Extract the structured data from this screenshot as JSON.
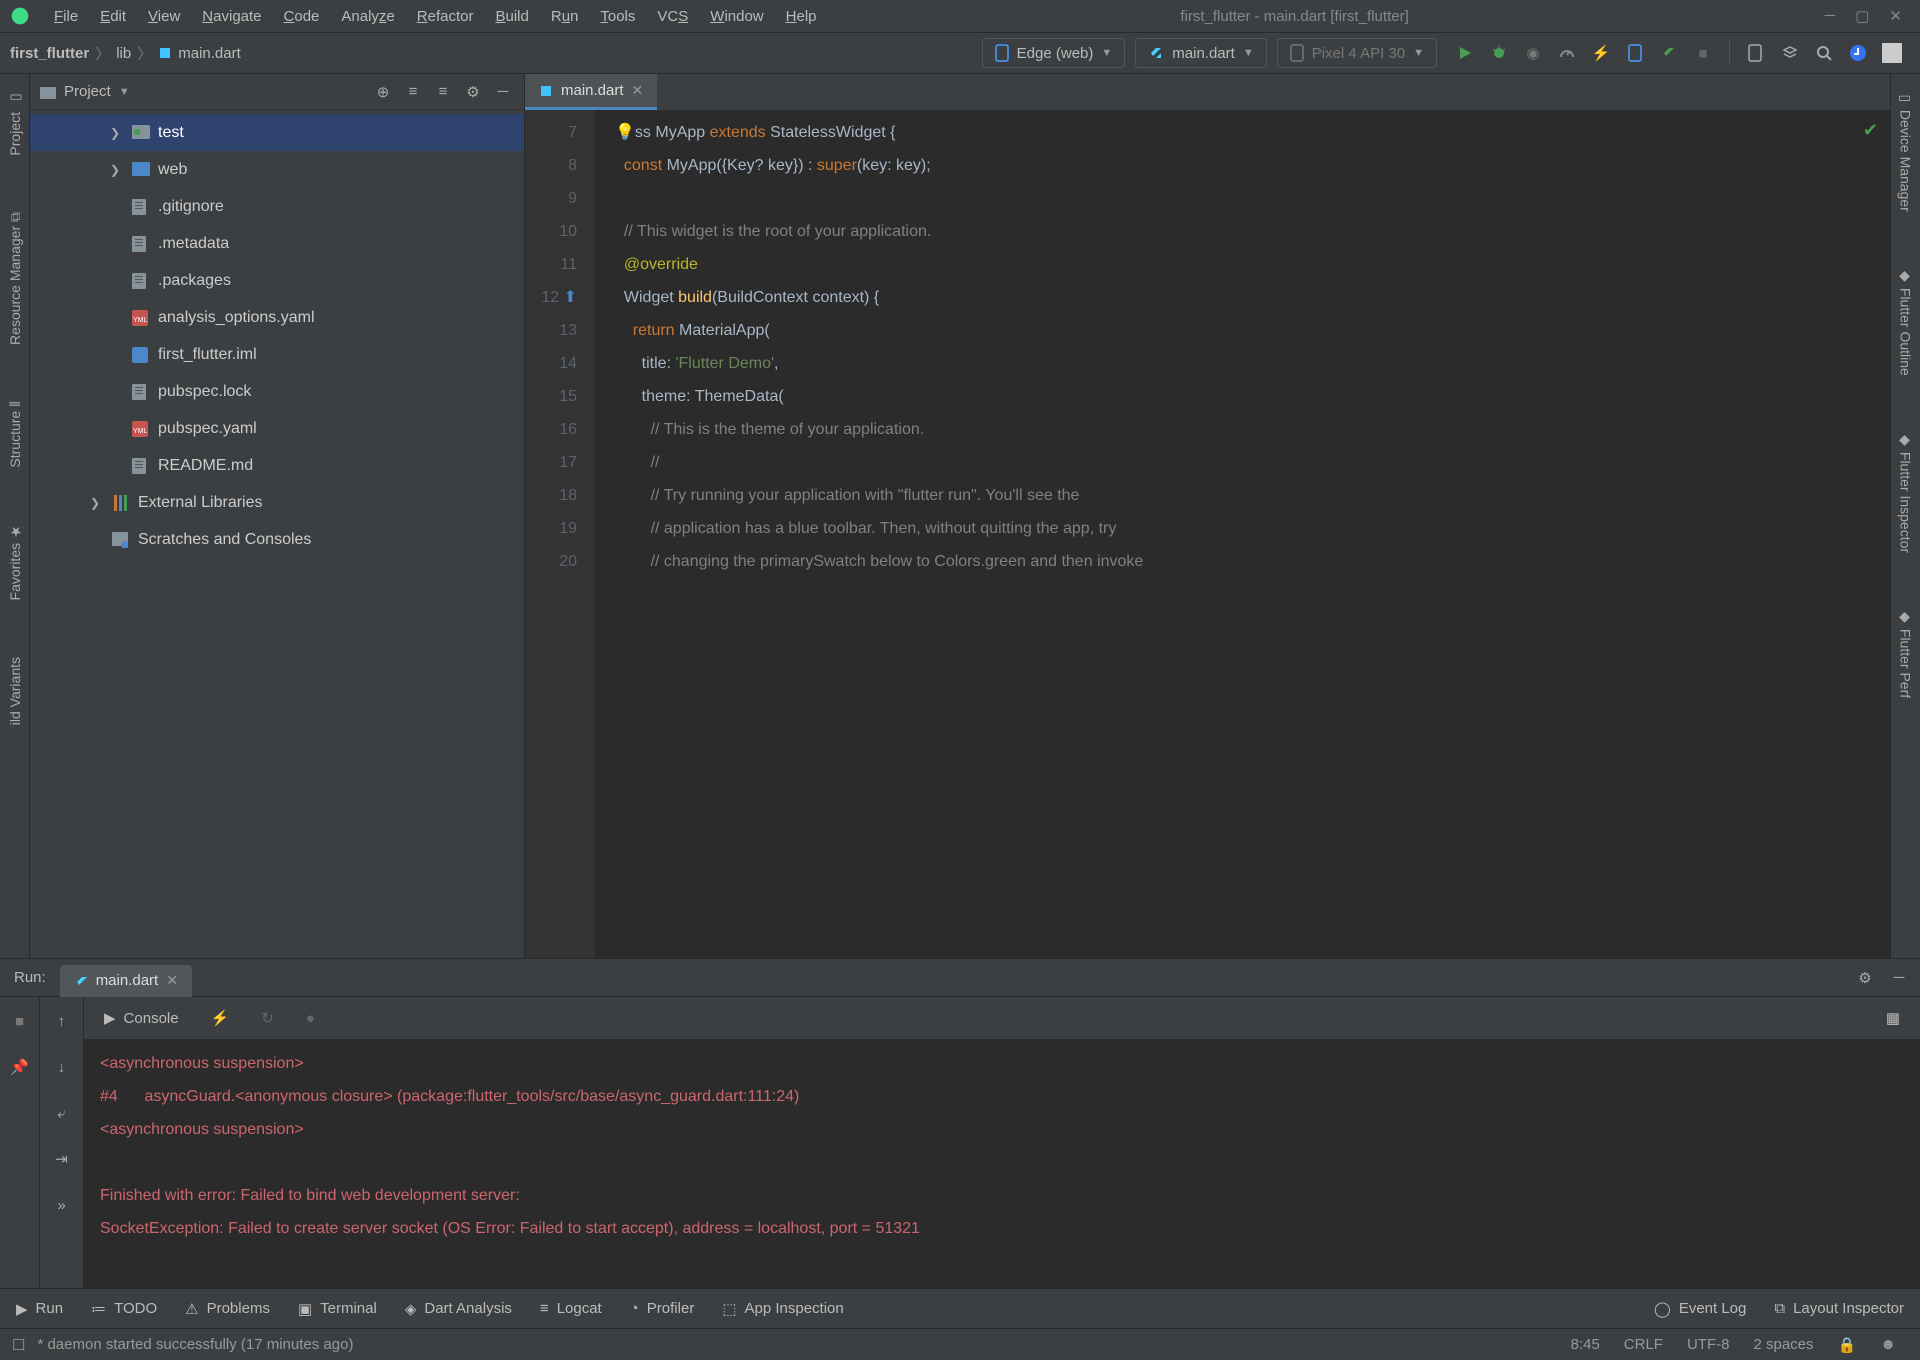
{
  "menubar": {
    "items": [
      "File",
      "Edit",
      "View",
      "Navigate",
      "Code",
      "Analyze",
      "Refactor",
      "Build",
      "Run",
      "Tools",
      "VCS",
      "Window",
      "Help"
    ],
    "window_title": "first_flutter - main.dart [first_flutter]"
  },
  "toolbar": {
    "breadcrumb": [
      "first_flutter",
      "lib",
      "main.dart"
    ],
    "device_dropdown": "Edge (web)",
    "config_dropdown": "main.dart",
    "emulator_dropdown": "Pixel 4 API 30"
  },
  "project_panel": {
    "title": "Project",
    "tree": [
      {
        "label": "test",
        "type": "folder-test",
        "exp": true,
        "indent": 1,
        "selected": true
      },
      {
        "label": "web",
        "type": "folder-web",
        "exp": true,
        "indent": 1
      },
      {
        "label": ".gitignore",
        "type": "file",
        "indent": 1
      },
      {
        "label": ".metadata",
        "type": "file",
        "indent": 1
      },
      {
        "label": ".packages",
        "type": "file",
        "indent": 1
      },
      {
        "label": "analysis_options.yaml",
        "type": "yaml",
        "indent": 1
      },
      {
        "label": "first_flutter.iml",
        "type": "iml",
        "indent": 1
      },
      {
        "label": "pubspec.lock",
        "type": "file",
        "indent": 1
      },
      {
        "label": "pubspec.yaml",
        "type": "yaml",
        "indent": 1
      },
      {
        "label": "README.md",
        "type": "file",
        "indent": 1
      },
      {
        "label": "External Libraries",
        "type": "lib",
        "exp": true,
        "indent": 0
      },
      {
        "label": "Scratches and Consoles",
        "type": "scratch",
        "indent": 0
      }
    ]
  },
  "editor": {
    "tab": "main.dart",
    "line_start": 7,
    "lines": [
      {
        "n": 7,
        "html": "<span class='kw'>class</span> MyApp <span class='kw'>extends</span> StatelessWidget {",
        "bulb": true
      },
      {
        "n": 8,
        "html": "  <span class='kw'>const</span> MyApp({Key? key}) : <span class='kw'>super</span>(key: key);"
      },
      {
        "n": 9,
        "html": ""
      },
      {
        "n": 10,
        "html": "  <span class='cmt'>// This widget is the root of your application.</span>"
      },
      {
        "n": 11,
        "html": "  <span class='ann'>@override</span>"
      },
      {
        "n": 12,
        "html": "  Widget <span class='mtd'>build</span>(BuildContext context) {",
        "override": true
      },
      {
        "n": 13,
        "html": "    <span class='kw'>return</span> MaterialApp("
      },
      {
        "n": 14,
        "html": "      title: <span class='str'>'Flutter Demo'</span>,"
      },
      {
        "n": 15,
        "html": "      theme: ThemeData("
      },
      {
        "n": 16,
        "html": "        <span class='cmt'>// This is the theme of your application.</span>"
      },
      {
        "n": 17,
        "html": "        <span class='cmt'>//</span>"
      },
      {
        "n": 18,
        "html": "        <span class='cmt'>// Try running your application with \"flutter run\". You'll see the</span>"
      },
      {
        "n": 19,
        "html": "        <span class='cmt'>// application has a blue toolbar. Then, without quitting the app, try</span>"
      },
      {
        "n": 20,
        "html": "        <span class='cmt'>// changing the primarySwatch below to Colors.green and then invoke</span>"
      }
    ]
  },
  "run_panel": {
    "label": "Run:",
    "tab": "main.dart",
    "console_label": "Console",
    "console_lines": [
      "<asynchronous suspension>",
      "#4      asyncGuard.<anonymous closure> (package:flutter_tools/src/base/async_guard.dart:111:24)",
      "<asynchronous suspension>",
      "",
      "Finished with error: Failed to bind web development server:",
      "SocketException: Failed to create server socket (OS Error: Failed to start accept), address = localhost, port = 51321"
    ]
  },
  "left_rail": [
    "Project",
    "Resource Manager",
    "Structure",
    "Favorites",
    "ild Variants"
  ],
  "right_rail": [
    "Device Manager",
    "Flutter Outline",
    "Flutter Inspector",
    "Flutter Perf"
  ],
  "bottombar": {
    "items": [
      "Run",
      "TODO",
      "Problems",
      "Terminal",
      "Dart Analysis",
      "Logcat",
      "Profiler",
      "App Inspection"
    ],
    "right": [
      "Event Log",
      "Layout Inspector"
    ]
  },
  "statusbar": {
    "msg": "* daemon started successfully (17 minutes ago)",
    "pos": "8:45",
    "eol": "CRLF",
    "enc": "UTF-8",
    "indent": "2 spaces"
  }
}
